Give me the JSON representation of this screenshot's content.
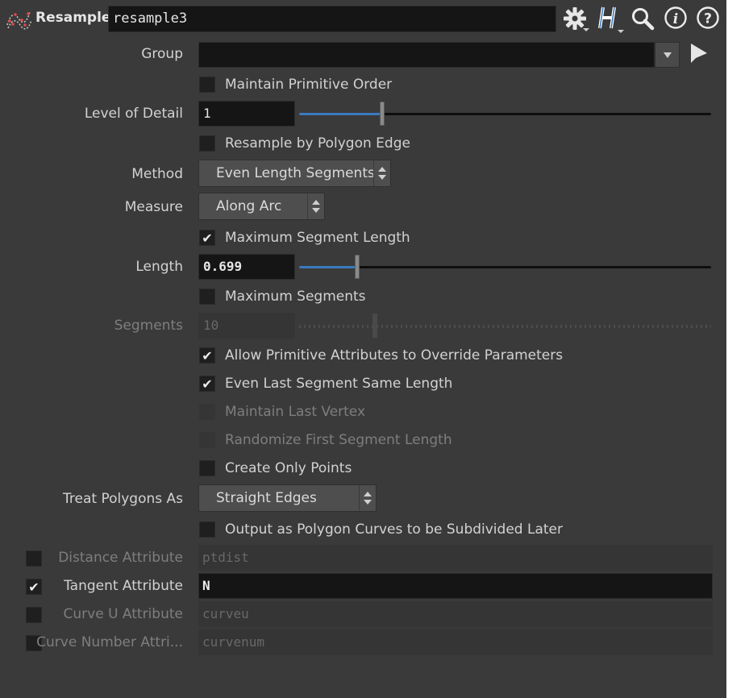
{
  "header": {
    "node_type": "Resample",
    "node_name": "resample3",
    "icons": [
      "gear-icon",
      "houdini-h-icon",
      "search-icon",
      "info-icon",
      "help-icon"
    ]
  },
  "group": {
    "label": "Group",
    "value": ""
  },
  "maintain_primitive_order": {
    "label": "Maintain Primitive Order",
    "checked": false
  },
  "level_of_detail": {
    "label": "Level of Detail",
    "value": "1",
    "slider_fraction": 0.2
  },
  "resample_by_polygon_edge": {
    "label": "Resample by Polygon Edge",
    "checked": false
  },
  "method": {
    "label": "Method",
    "value": "Even Length Segments"
  },
  "measure": {
    "label": "Measure",
    "value": "Along Arc"
  },
  "maximum_segment_length": {
    "label": "Maximum Segment Length",
    "checked": true
  },
  "length": {
    "label": "Length",
    "value": "0.699",
    "slider_fraction": 0.14
  },
  "maximum_segments": {
    "label": "Maximum Segments",
    "checked": false
  },
  "segments": {
    "label": "Segments",
    "value": "10",
    "slider_fraction": 0.18,
    "disabled": true
  },
  "allow_prim_attrs": {
    "label": "Allow Primitive Attributes to Override Parameters",
    "checked": true
  },
  "even_last_segment": {
    "label": "Even Last Segment Same Length",
    "checked": true
  },
  "maintain_last_vertex": {
    "label": "Maintain Last Vertex",
    "disabled": true
  },
  "randomize_first_segment": {
    "label": "Randomize First Segment Length",
    "disabled": true
  },
  "create_only_points": {
    "label": "Create Only Points",
    "checked": false
  },
  "treat_polygons_as": {
    "label": "Treat Polygons As",
    "value": "Straight Edges"
  },
  "output_as_polygon_curves": {
    "label": "Output as Polygon Curves to be Subdivided Later",
    "checked": false
  },
  "attributes": [
    {
      "label": "Distance Attribute",
      "value": "ptdist",
      "enabled": false
    },
    {
      "label": "Tangent Attribute",
      "value": "N",
      "enabled": true
    },
    {
      "label": "Curve U Attribute",
      "value": "curveu",
      "enabled": false
    },
    {
      "label": "Curve Number Attri...",
      "value": "curvenum",
      "enabled": false
    }
  ],
  "colors": {
    "panel": "#3a3a3a",
    "field": "#151515",
    "slider_fill": "#3b7ac0",
    "disabled_text": "#7e7e7e"
  }
}
